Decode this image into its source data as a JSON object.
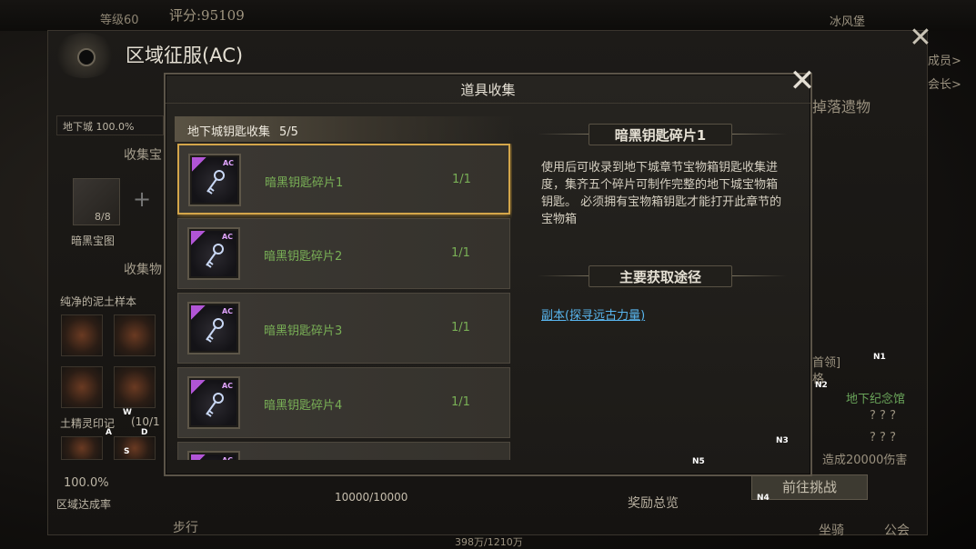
{
  "topbar": {
    "level": "等级60",
    "score": "评分:95109",
    "region": "冰风堡"
  },
  "outer": {
    "title": "区域征服(AC)",
    "close_label": "✕",
    "left": {
      "stat": "地下城   100.0%",
      "section1": "收集宝",
      "box_count": "8/8",
      "box_label": "暗黑宝图",
      "section2": "收集物",
      "item_label1": "纯净的泥土样本",
      "item_label2": "土精灵印记",
      "item_count2": "(10/1",
      "rate": "100.0%",
      "rate_label": "区域达成率"
    },
    "right": {
      "member": "成员>",
      "chairman": "会长>",
      "drop": "掉落遗物",
      "boss": "首领]",
      "grid": "格",
      "memorial": "地下纪念馆",
      "unknown1": "? ? ?",
      "unknown2": "? ? ?",
      "damage": "造成20000伤害",
      "challenge": "前往挑战"
    },
    "progress": "10000/10000",
    "reward_overview": "奖励总览",
    "mount": "坐骑",
    "guild": "公会",
    "walk": "步行",
    "gold": "398万/1210万"
  },
  "markers": {
    "n1": "N1",
    "n2": "N2",
    "n3": "N3",
    "n4": "N4",
    "n5": "N5",
    "w": "W",
    "a": "A",
    "d": "D",
    "s": "S"
  },
  "modal": {
    "title": "道具收集",
    "close_label": "✕",
    "collection": {
      "name": "地下城钥匙收集",
      "count": "5/5"
    },
    "items": [
      {
        "name": "暗黑钥匙碎片1",
        "qty": "1/1",
        "tag": "AC"
      },
      {
        "name": "暗黑钥匙碎片2",
        "qty": "1/1",
        "tag": "AC"
      },
      {
        "name": "暗黑钥匙碎片3",
        "qty": "1/1",
        "tag": "AC"
      },
      {
        "name": "暗黑钥匙碎片4",
        "qty": "1/1",
        "tag": "AC"
      },
      {
        "name": "",
        "qty": "",
        "tag": "AC"
      }
    ],
    "detail": {
      "title": "暗黑钥匙碎片1",
      "description": "使用后可收录到地下城章节宝物箱钥匙收集进度，集齐五个碎片可制作完整的地下城宝物箱钥匙。 必须拥有宝物箱钥匙才能打开此章节的宝物箱",
      "source_title": "主要获取途径",
      "source_link": "副本(探寻远古力量)"
    }
  },
  "colors": {
    "selected_border": "#d4a64a",
    "item_name": "#79b056",
    "link": "#58b5ee",
    "ac_badge": "#b155d6"
  },
  "icons": {
    "item": "dark-key-icon",
    "close": "close-icon",
    "emblem": "conquest-emblem-icon"
  }
}
